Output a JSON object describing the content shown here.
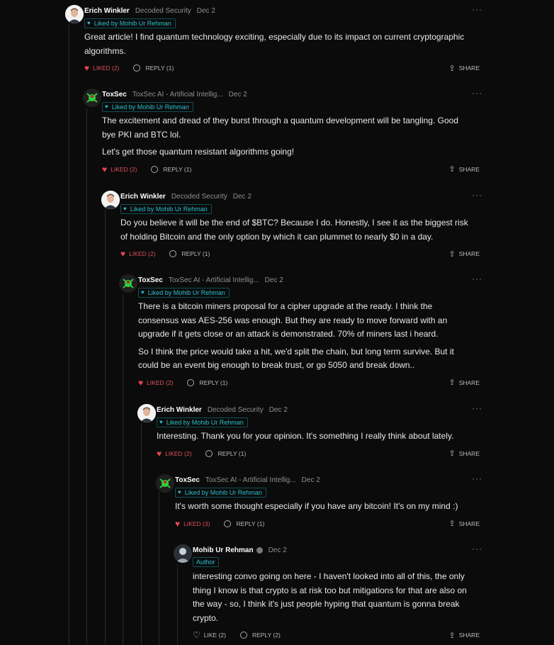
{
  "comments": [
    {
      "name": "Erich Winkler",
      "publication": "Decoded Security",
      "date": "Dec 2",
      "badge": "Liked by Mohib Ur Rehman",
      "paragraphs": [
        "Great article! I find quantum technology exciting, especially due to its impact on current cryptographic algorithms."
      ],
      "like_label": "LIKED (2)",
      "reply_label": "REPLY (1)",
      "share_label": "SHARE",
      "avatar": "erich-avatar"
    },
    {
      "name": "ToxSec",
      "publication": "ToxSec AI - Artificial Intellig...",
      "date": "Dec 2",
      "badge": "Liked by Mohib Ur Rehman",
      "paragraphs": [
        "The excitement and dread of they burst through a quantum development will be tangling. Good bye PKI and BTC lol.",
        "Let's get those quantum resistant algorithms going!"
      ],
      "like_label": "LIKED (2)",
      "reply_label": "REPLY (1)",
      "share_label": "SHARE",
      "avatar": "toxsec-avatar"
    },
    {
      "name": "Erich Winkler",
      "publication": "Decoded Security",
      "date": "Dec 2",
      "badge": "Liked by Mohib Ur Rehman",
      "paragraphs": [
        "Do you believe it will be the end of $BTC? Because I do. Honestly, I see it as the biggest risk of holding Bitcoin and the only option by which it can plummet to nearly $0 in a day."
      ],
      "like_label": "LIKED (2)",
      "reply_label": "REPLY (1)",
      "share_label": "SHARE",
      "avatar": "erich-avatar"
    },
    {
      "name": "ToxSec",
      "publication": "ToxSec AI - Artificial Intellig...",
      "date": "Dec 2",
      "badge": "Liked by Mohib Ur Rehman",
      "paragraphs": [
        "There is a bitcoin miners proposal for a cipher upgrade at the ready. I think the consensus was AES-256 was enough. But they are ready to move forward with an upgrade if it gets close or an attack is demonstrated. 70% of miners last i heard.",
        "So I think the price would take a hit, we'd split the chain, but long term survive. But it could be an event big enough to break trust, or go 5050 and break down.."
      ],
      "like_label": "LIKED (2)",
      "reply_label": "REPLY (1)",
      "share_label": "SHARE",
      "avatar": "toxsec-avatar"
    },
    {
      "name": "Erich Winkler",
      "publication": "Decoded Security",
      "date": "Dec 2",
      "badge": "Liked by Mohib Ur Rehman",
      "paragraphs": [
        "Interesting. Thank you for your opinion. It's something I really think about lately."
      ],
      "like_label": "LIKED (2)",
      "reply_label": "REPLY (1)",
      "share_label": "SHARE",
      "avatar": "erich-avatar"
    },
    {
      "name": "ToxSec",
      "publication": "ToxSec AI - Artificial Intellig...",
      "date": "Dec 2",
      "badge": "Liked by Mohib Ur Rehman",
      "paragraphs": [
        "It's worth some thought especially if you have any bitcoin! It's on my mind :)"
      ],
      "like_label": "LIKED (3)",
      "reply_label": "REPLY (1)",
      "share_label": "SHARE",
      "avatar": "toxsec-avatar"
    },
    {
      "name": "Mohib Ur Rehman",
      "publication": "",
      "date": "Dec 2",
      "badge": "Author",
      "paragraphs": [
        "interesting convo going on here - I haven't looked into all of this, the only thing I know is that crypto is at risk too but mitigations for that are also on the way - so, I think it's just people hyping that quantum is gonna break crypto."
      ],
      "like_label": "LIKE (2)",
      "reply_label": "REPLY (2)",
      "share_label": "SHARE",
      "avatar": "mohib-avatar"
    }
  ],
  "icons": {
    "heart": "heart-icon",
    "reply": "reply-icon",
    "share": "share-icon",
    "more": "more-options-icon",
    "verified": "verified-badge-icon"
  },
  "colors": {
    "background": "#0b0b0b",
    "liked": "#e8454f",
    "badge": "#2bbfcf"
  }
}
